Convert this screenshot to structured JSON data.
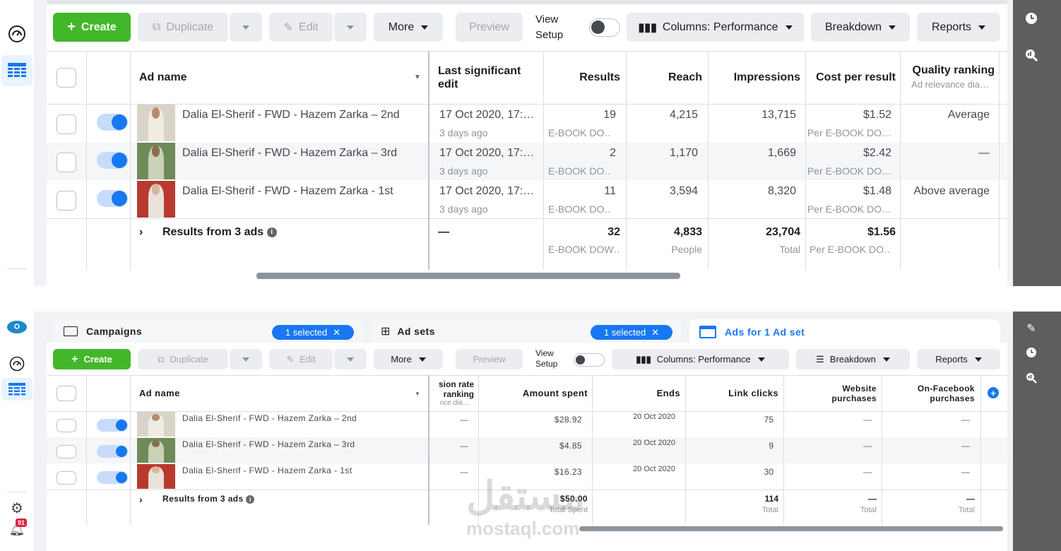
{
  "top": {
    "toolbar": {
      "create": "Create",
      "duplicate": "Duplicate",
      "edit": "Edit",
      "more": "More",
      "preview": "Preview",
      "view_setup_1": "View",
      "view_setup_2": "Setup",
      "columns": "Columns: Performance",
      "breakdown": "Breakdown",
      "reports": "Reports"
    },
    "headers": {
      "ad_name": "Ad name",
      "last_edit_1": "Last significant",
      "last_edit_2": "edit",
      "results": "Results",
      "reach": "Reach",
      "impressions": "Impressions",
      "cost": "Cost per result",
      "quality": "Quality ranking",
      "quality_sub": "Ad relevance dia…"
    },
    "rows": [
      {
        "name": "Dalia El-Sherif - FWD - Hazem Zarka – 2nd",
        "edit": "17 Oct 2020, 17:…",
        "edit_sub": "3 days ago",
        "results": "19",
        "results_sub": "E-BOOK DO…",
        "reach": "4,215",
        "impressions": "13,715",
        "cost": "$1.52",
        "cost_sub": "Per E-BOOK DO…",
        "quality": "Average"
      },
      {
        "name": "Dalia El-Sherif - FWD - Hazem Zarka – 3rd",
        "edit": "17 Oct 2020, 17:…",
        "edit_sub": "3 days ago",
        "results": "2",
        "results_sub": "E-BOOK DO…",
        "reach": "1,170",
        "impressions": "1,669",
        "cost": "$2.42",
        "cost_sub": "Per E-BOOK DO…",
        "quality": "—"
      },
      {
        "name": "Dalia El-Sherif - FWD - Hazem Zarka - 1st",
        "edit": "17 Oct 2020, 17:…",
        "edit_sub": "3 days ago",
        "results": "11",
        "results_sub": "E-BOOK DO…",
        "reach": "3,594",
        "impressions": "8,320",
        "cost": "$1.48",
        "cost_sub": "Per E-BOOK DO…",
        "quality": "Above average"
      }
    ],
    "summary": {
      "label": "Results from 3 ads",
      "edit": "—",
      "results": "32",
      "results_sub": "E-BOOK DOW…",
      "reach": "4,833",
      "reach_sub": "People",
      "impressions": "23,704",
      "impressions_sub": "Total",
      "cost": "$1.56",
      "cost_sub": "Per E-BOOK DO…"
    }
  },
  "bottom": {
    "tabs": {
      "campaigns": "Campaigns",
      "campaigns_pill": "1 selected",
      "adsets": "Ad sets",
      "adsets_pill": "1 selected",
      "ads": "Ads for 1 Ad set"
    },
    "toolbar": {
      "create": "Create",
      "duplicate": "Duplicate",
      "edit": "Edit",
      "more": "More",
      "preview": "Preview",
      "view_setup_1": "View",
      "view_setup_2": "Setup",
      "columns": "Columns: Performance",
      "breakdown": "Breakdown",
      "reports": "Reports"
    },
    "headers": {
      "ad_name": "Ad name",
      "ranking_1": "sion rate",
      "ranking_2": "ranking",
      "ranking_sub": "nce dia…",
      "amount": "Amount spent",
      "ends": "Ends",
      "link": "Link clicks",
      "website_1": "Website",
      "website_2": "purchases",
      "onfb_1": "On-Facebook",
      "onfb_2": "purchases"
    },
    "rows": [
      {
        "name": "Dalia El-Sherif - FWD - Hazem Zarka – 2nd",
        "ranking": "—",
        "amount": "$28.92",
        "ends": "20 Oct 2020",
        "link": "75",
        "website": "—",
        "onfb": "—"
      },
      {
        "name": "Dalia El-Sherif - FWD - Hazem Zarka – 3rd",
        "ranking": "—",
        "amount": "$4.85",
        "ends": "20 Oct 2020",
        "link": "9",
        "website": "—",
        "onfb": "—"
      },
      {
        "name": "Dalia El-Sherif - FWD - Hazem Zarka - 1st",
        "ranking": "—",
        "amount": "$16.23",
        "ends": "20 Oct 2020",
        "link": "30",
        "website": "—",
        "onfb": "—"
      }
    ],
    "summary": {
      "label": "Results from 3 ads",
      "amount": "$50.00",
      "amount_sub": "Total Spent",
      "link": "114",
      "link_sub": "Total",
      "website": "—",
      "website_sub": "Total",
      "onfb": "—",
      "onfb_sub": "Total"
    },
    "notification_count": "91"
  },
  "watermark": {
    "arabic": "مستقل",
    "latin": "mostaql.com"
  },
  "colors": {
    "accent": "#1877f2",
    "create_green": "#42b72a",
    "right_rail": "#5e5e5e"
  }
}
